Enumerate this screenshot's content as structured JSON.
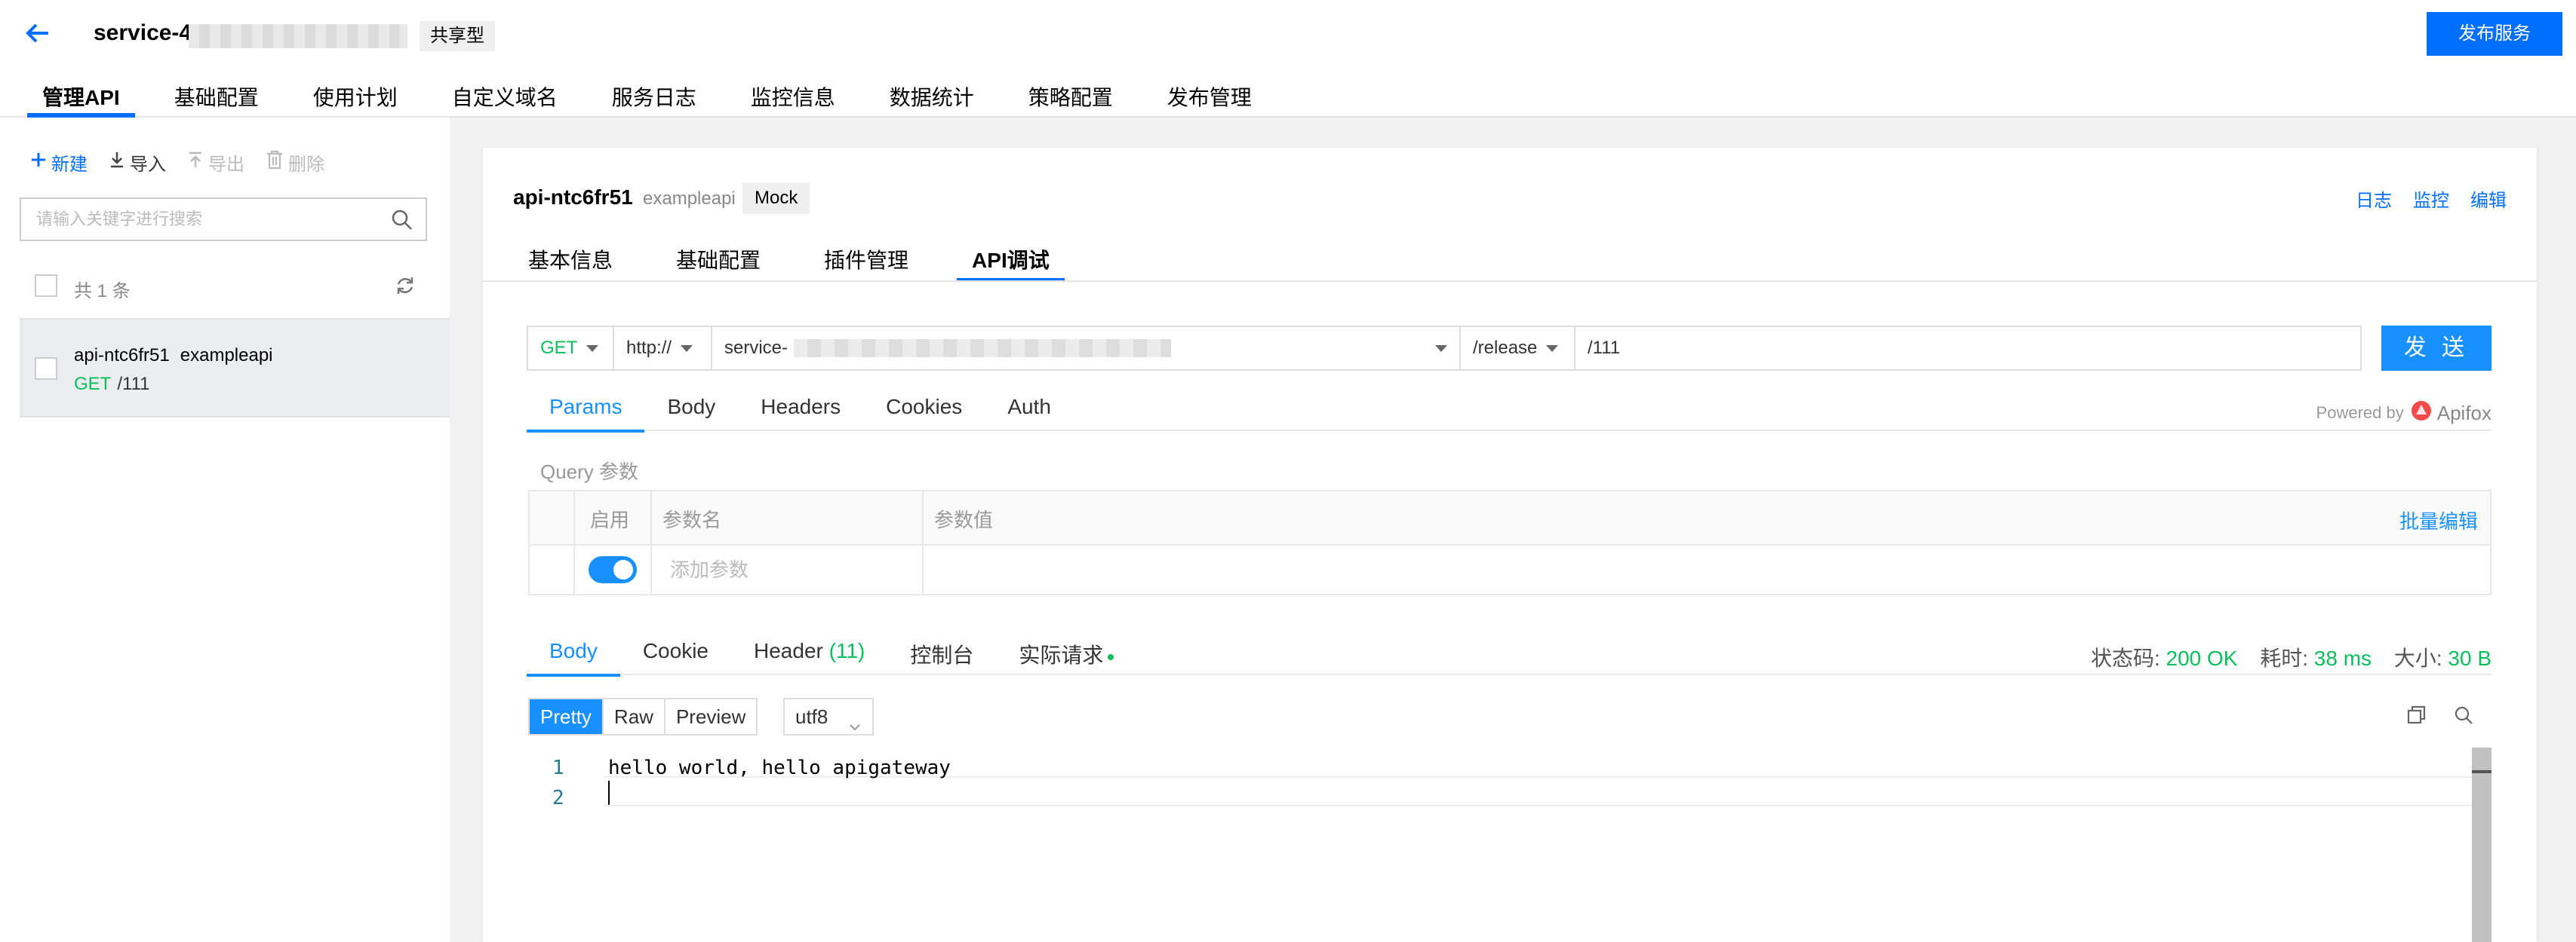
{
  "header": {
    "title": "service-4",
    "badge": "共享型",
    "publish_label": "发布服务"
  },
  "main_tabs": [
    {
      "label": "管理API",
      "active": true
    },
    {
      "label": "基础配置"
    },
    {
      "label": "使用计划"
    },
    {
      "label": "自定义域名"
    },
    {
      "label": "服务日志"
    },
    {
      "label": "监控信息"
    },
    {
      "label": "数据统计"
    },
    {
      "label": "策略配置"
    },
    {
      "label": "发布管理"
    }
  ],
  "sidebar": {
    "toolbar": {
      "new": "新建",
      "import": "导入",
      "export": "导出",
      "delete": "删除"
    },
    "search_placeholder": "请输入关键字进行搜索",
    "count_text": "共 1 条",
    "items": [
      {
        "name": "api-ntc6fr51",
        "tag": "exampleapi",
        "method": "GET",
        "path": "/111"
      }
    ]
  },
  "panel": {
    "api_name": "api-ntc6fr51",
    "api_sub": "exampleapi",
    "mock_tag": "Mock",
    "links": [
      "日志",
      "监控",
      "编辑"
    ],
    "tabs": [
      {
        "label": "基本信息"
      },
      {
        "label": "基础配置"
      },
      {
        "label": "插件管理"
      },
      {
        "label": "API调试",
        "active": true
      }
    ]
  },
  "request": {
    "method": "GET",
    "protocol": "http://",
    "host": "service-",
    "env": "/release",
    "path": "/111",
    "send_label": "发 送"
  },
  "param_tabs": [
    {
      "label": "Params",
      "active": true
    },
    {
      "label": "Body"
    },
    {
      "label": "Headers"
    },
    {
      "label": "Cookies"
    },
    {
      "label": "Auth"
    }
  ],
  "powered_by": {
    "prefix": "Powered by",
    "brand": "Apifox"
  },
  "query": {
    "label": "Query 参数",
    "col_enable": "启用",
    "col_name": "参数名",
    "col_value": "参数值",
    "bulk_edit": "批量编辑",
    "add_placeholder": "添加参数"
  },
  "response_tabs": [
    {
      "label": "Body",
      "active": true
    },
    {
      "label": "Cookie"
    },
    {
      "label": "Header",
      "count": "(11)"
    },
    {
      "label": "控制台"
    },
    {
      "label": "实际请求"
    }
  ],
  "response_meta": {
    "status_label": "状态码:",
    "status_value": "200 OK",
    "time_label": "耗时:",
    "time_value": "38 ms",
    "size_label": "大小:",
    "size_value": "30 B"
  },
  "view_modes": [
    "Pretty",
    "Raw",
    "Preview"
  ],
  "encoding": "utf8",
  "code_lines": [
    {
      "num": "1",
      "text": "hello world, hello apigateway"
    },
    {
      "num": "2",
      "text": ""
    }
  ],
  "colors": {
    "primary": "#006eff",
    "link": "#1890ff",
    "success": "#0abf5b"
  },
  "icons": [
    "back-arrow-icon",
    "plus-icon",
    "download-icon",
    "upload-icon",
    "trash-icon",
    "search-icon",
    "refresh-icon",
    "chevron-down-icon",
    "copy-icon",
    "find-icon",
    "apifox-logo-icon"
  ]
}
